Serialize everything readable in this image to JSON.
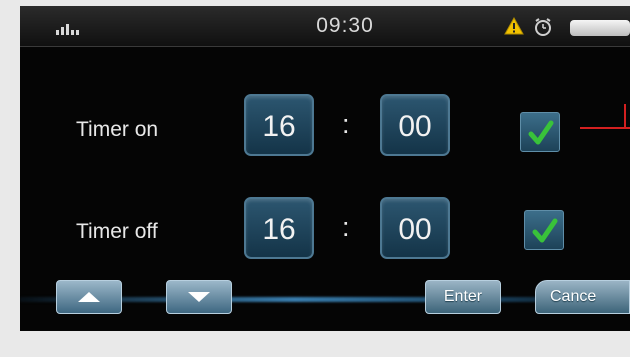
{
  "status_bar": {
    "time": "09:30",
    "signal_icon": "signal-bars-icon",
    "warning_icon": "warning-icon",
    "alarm_icon": "alarm-clock-icon",
    "battery_icon": "battery-icon"
  },
  "timer_on": {
    "label": "Timer on",
    "hour": "16",
    "separator": ":",
    "minute": "00",
    "enabled": true
  },
  "timer_off": {
    "label": "Timer off",
    "hour": "16",
    "separator": ":",
    "minute": "00",
    "enabled": true
  },
  "buttons": {
    "up_icon": "arrow-up-icon",
    "down_icon": "arrow-down-icon",
    "enter_label": "Enter",
    "cancel_label": "Cance"
  },
  "colors": {
    "box_fill": "#1f4a63",
    "check_green": "#39c23a",
    "annotation_red": "#d42020"
  }
}
